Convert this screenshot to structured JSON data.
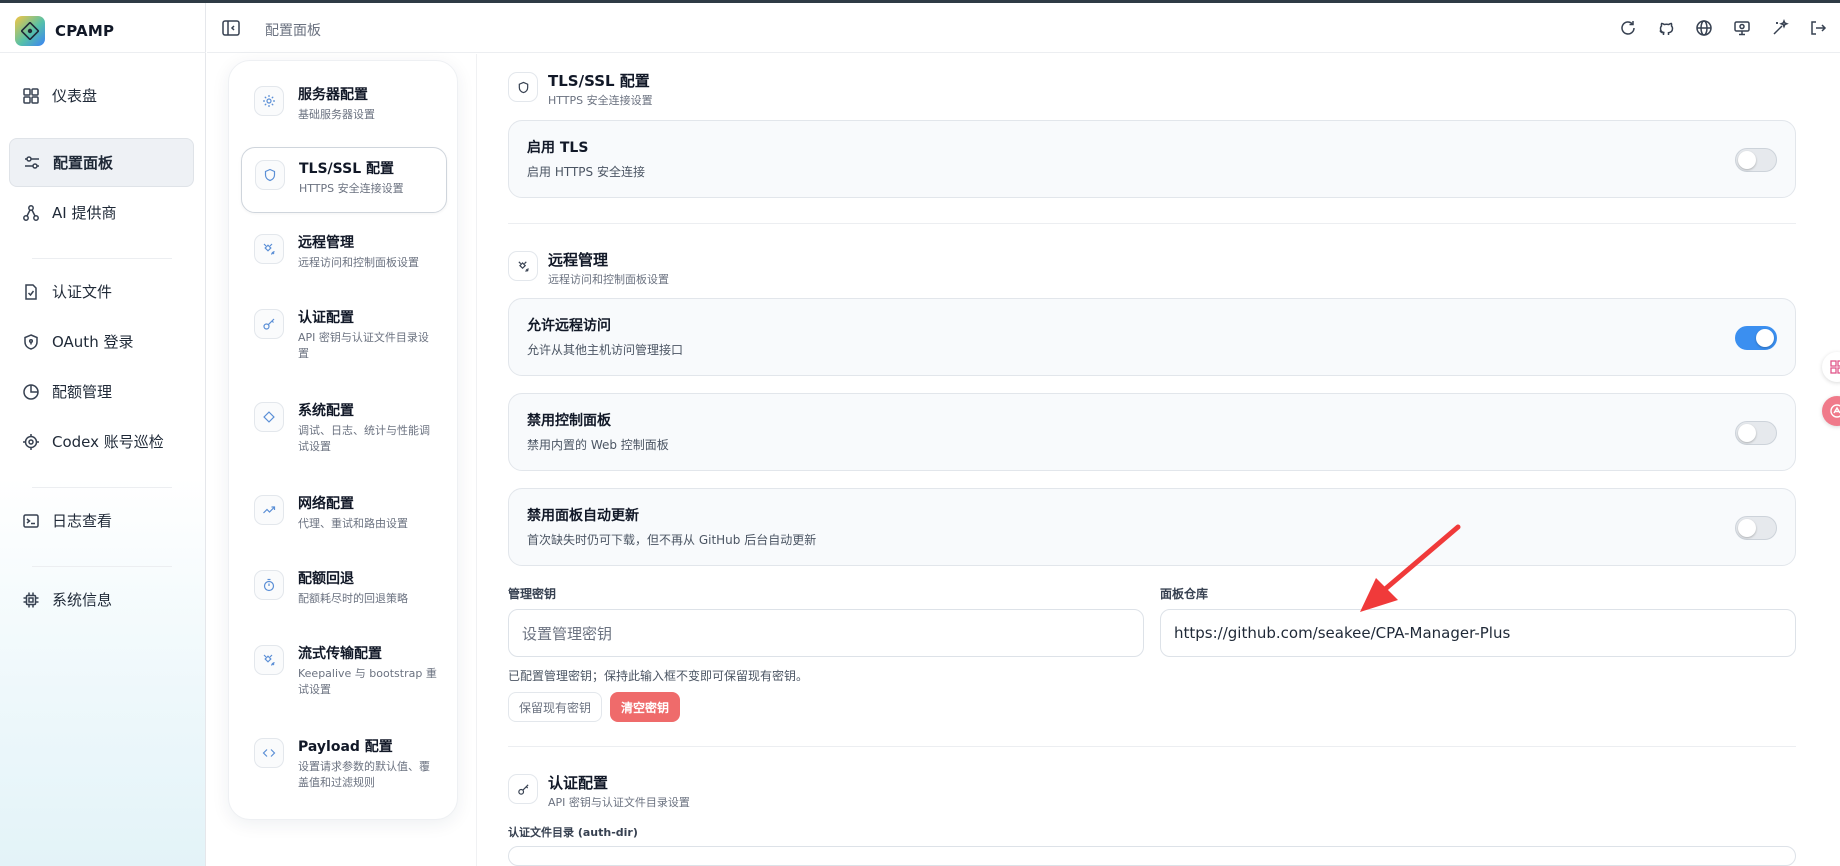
{
  "brand": {
    "name": "CPAMP"
  },
  "header": {
    "breadcrumb": "配置面板"
  },
  "sidebar": {
    "items": [
      {
        "label": "仪表盘",
        "icon": "dashboard-icon"
      },
      {
        "label": "配置面板",
        "icon": "sliders-icon",
        "active": true
      },
      {
        "label": "AI 提供商",
        "icon": "network-icon"
      },
      {
        "label": "认证文件",
        "icon": "file-check-icon"
      },
      {
        "label": "OAuth 登录",
        "icon": "shield-icon"
      },
      {
        "label": "配额管理",
        "icon": "pie-chart-icon"
      },
      {
        "label": "Codex 账号巡检",
        "icon": "target-icon"
      },
      {
        "label": "日志查看",
        "icon": "terminal-icon"
      },
      {
        "label": "系统信息",
        "icon": "chip-icon"
      }
    ]
  },
  "subnav": {
    "items": [
      {
        "title": "服务器配置",
        "desc": "基础服务器设置",
        "icon": "gear-icon"
      },
      {
        "title": "TLS/SSL 配置",
        "desc": "HTTPS 安全连接设置",
        "icon": "shield-icon",
        "active": true
      },
      {
        "title": "远程管理",
        "desc": "远程访问和控制面板设置",
        "icon": "satellite-icon"
      },
      {
        "title": "认证配置",
        "desc": "API 密钥与认证文件目录设置",
        "icon": "key-icon"
      },
      {
        "title": "系统配置",
        "desc": "调试、日志、统计与性能调试设置",
        "icon": "diamond-icon"
      },
      {
        "title": "网络配置",
        "desc": "代理、重试和路由设置",
        "icon": "trend-icon"
      },
      {
        "title": "配额回退",
        "desc": "配额耗尽时的回退策略",
        "icon": "timer-icon"
      },
      {
        "title": "流式传输配置",
        "desc": "Keepalive 与 bootstrap 重试设置",
        "icon": "satellite-icon"
      },
      {
        "title": "Payload 配置",
        "desc": "设置请求参数的默认值、覆盖值和过滤规则",
        "icon": "code-icon"
      }
    ]
  },
  "main": {
    "tls": {
      "title": "TLS/SSL 配置",
      "desc": "HTTPS 安全连接设置",
      "enable_tls": {
        "title": "启用 TLS",
        "desc": "启用 HTTPS 安全连接",
        "on": false
      }
    },
    "remote": {
      "title": "远程管理",
      "desc": "远程访问和控制面板设置",
      "allow_remote": {
        "title": "允许远程访问",
        "desc": "允许从其他主机访问管理接口",
        "on": true
      },
      "disable_panel": {
        "title": "禁用控制面板",
        "desc": "禁用内置的 Web 控制面板",
        "on": false
      },
      "disable_auto_update": {
        "title": "禁用面板自动更新",
        "desc": "首次缺失时仍可下载，但不再从 GitHub 后台自动更新",
        "on": false
      },
      "secret_label": "管理密钥",
      "secret_placeholder": "设置管理密钥",
      "repo_label": "面板仓库",
      "repo_value": "https://github.com/seakee/CPA-Manager-Plus",
      "hint": "已配置管理密钥；保持此输入框不变即可保留现有密钥。",
      "keep_button": "保留现有密钥",
      "clear_button": "清空密钥"
    },
    "auth": {
      "title": "认证配置",
      "desc": "API 密钥与认证文件目录设置",
      "auth_dir_label": "认证文件目录 (auth-dir)"
    }
  },
  "colors": {
    "accent": "#3b8ff0",
    "danger": "#ef6b6b",
    "annotation_arrow": "#f03a3a"
  }
}
